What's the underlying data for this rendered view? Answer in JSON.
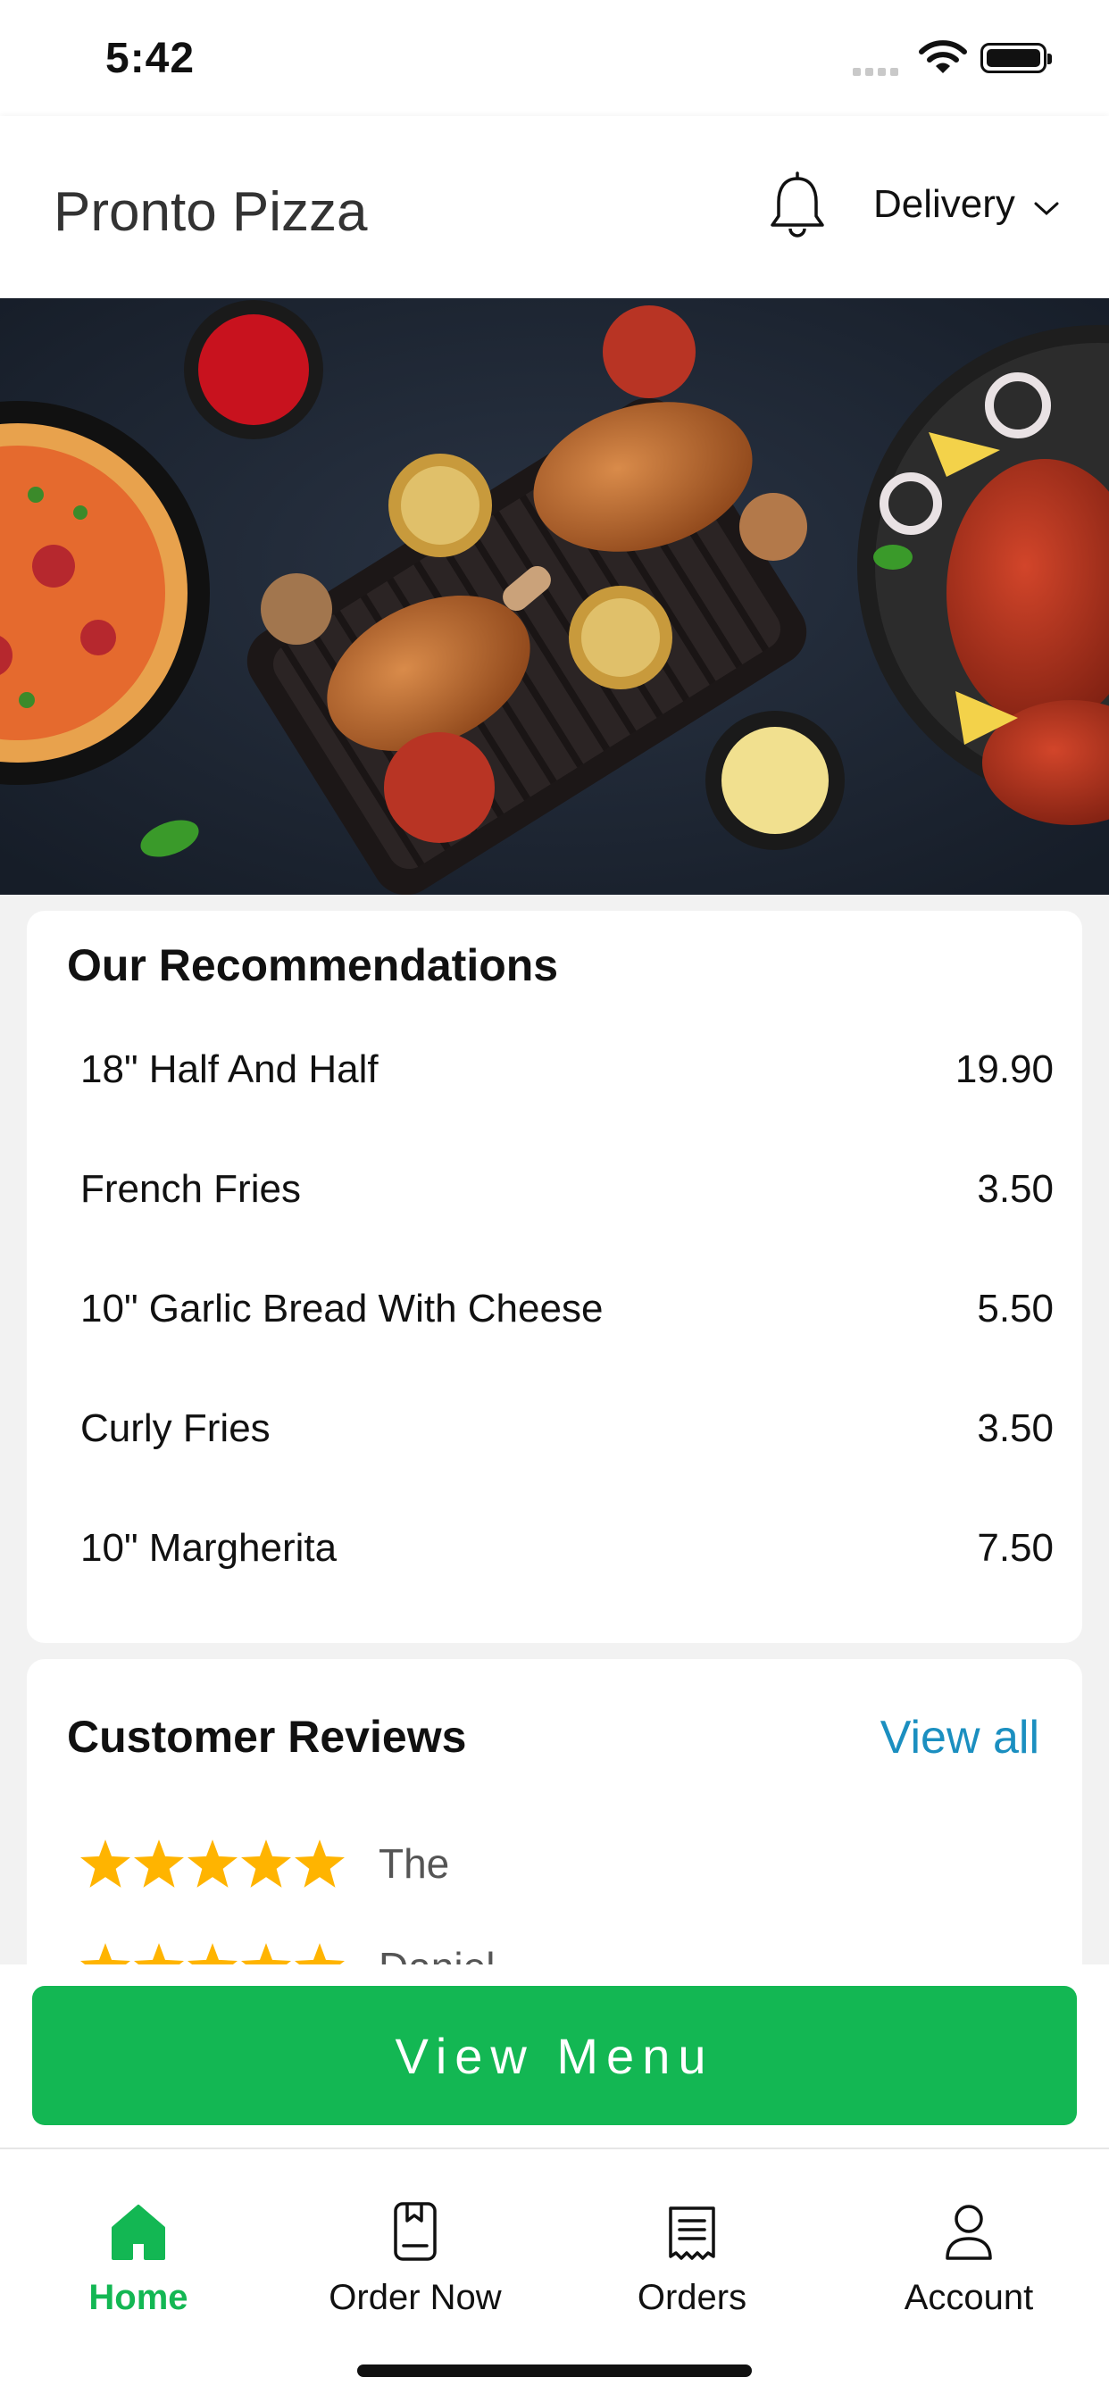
{
  "status_bar": {
    "time": "5:42"
  },
  "header": {
    "title": "Pronto Pizza",
    "mode_label": "Delivery"
  },
  "hero": {
    "image": "food-banner-grilled-chicken-pizza"
  },
  "recommendations": {
    "heading": "Our Recommendations",
    "items": [
      {
        "name": "18\" Half And Half",
        "price": "19.90"
      },
      {
        "name": "French Fries",
        "price": "3.50"
      },
      {
        "name": "10\" Garlic Bread With Cheese",
        "price": "5.50"
      },
      {
        "name": "Curly Fries",
        "price": "3.50"
      },
      {
        "name": "10\" Margherita",
        "price": "7.50"
      }
    ]
  },
  "reviews": {
    "heading": "Customer Reviews",
    "view_all": "View all",
    "items": [
      {
        "rating": 5,
        "text": "The"
      },
      {
        "rating": 5,
        "text": "Daniel"
      }
    ]
  },
  "cta": {
    "label": "View Menu"
  },
  "tabs": [
    {
      "label": "Home",
      "icon": "home-icon",
      "active": true
    },
    {
      "label": "Order Now",
      "icon": "order-book-icon",
      "active": false
    },
    {
      "label": "Orders",
      "icon": "receipt-icon",
      "active": false
    },
    {
      "label": "Account",
      "icon": "user-icon",
      "active": false
    }
  ],
  "colors": {
    "accent_green": "#13b753",
    "link_blue": "#1b8fc0",
    "star_yellow": "#ffb400"
  }
}
